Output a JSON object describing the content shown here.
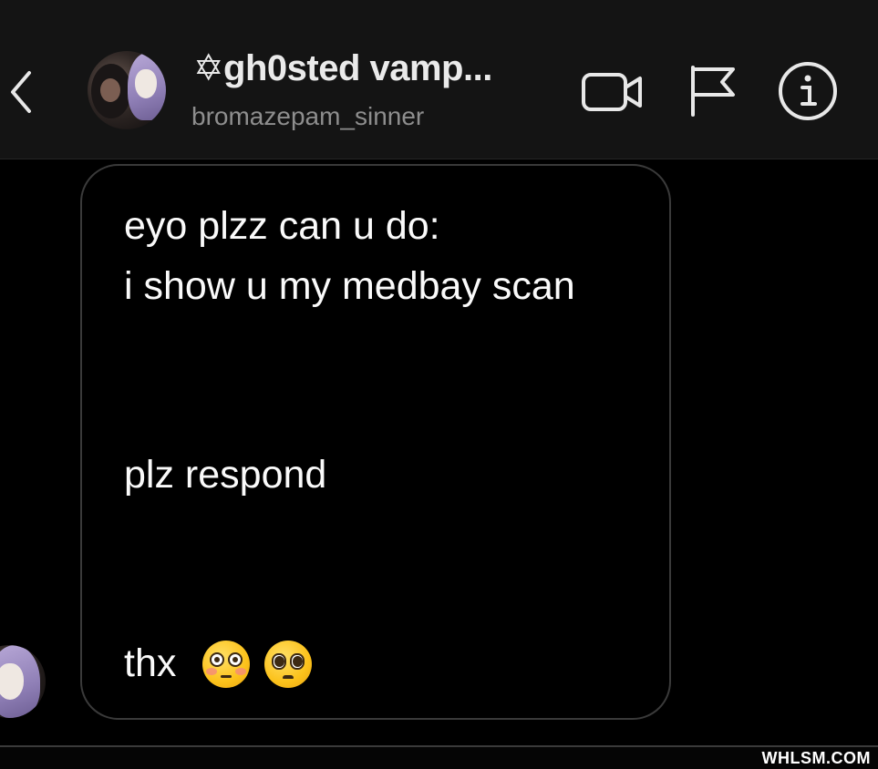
{
  "header": {
    "title": "✡gh0sted vamp...",
    "subtitle": "bromazepam_sinner",
    "icons": {
      "back": "chevron-left-icon",
      "video": "video-camera-icon",
      "flag": "flag-icon",
      "info": "info-icon"
    }
  },
  "message": {
    "lines": [
      "eyo plzz can u do:",
      "i show u my medbay scan",
      "plz respond",
      "thx"
    ],
    "emojis": [
      "flushed-face-emoji",
      "pleading-face-emoji"
    ]
  },
  "watermark": "WHLSM.COM",
  "colors": {
    "background": "#000000",
    "header_bg": "#141414",
    "bubble_border": "#3a3a3a",
    "text": "#fafafa",
    "subtitle": "#8e8e8e"
  }
}
